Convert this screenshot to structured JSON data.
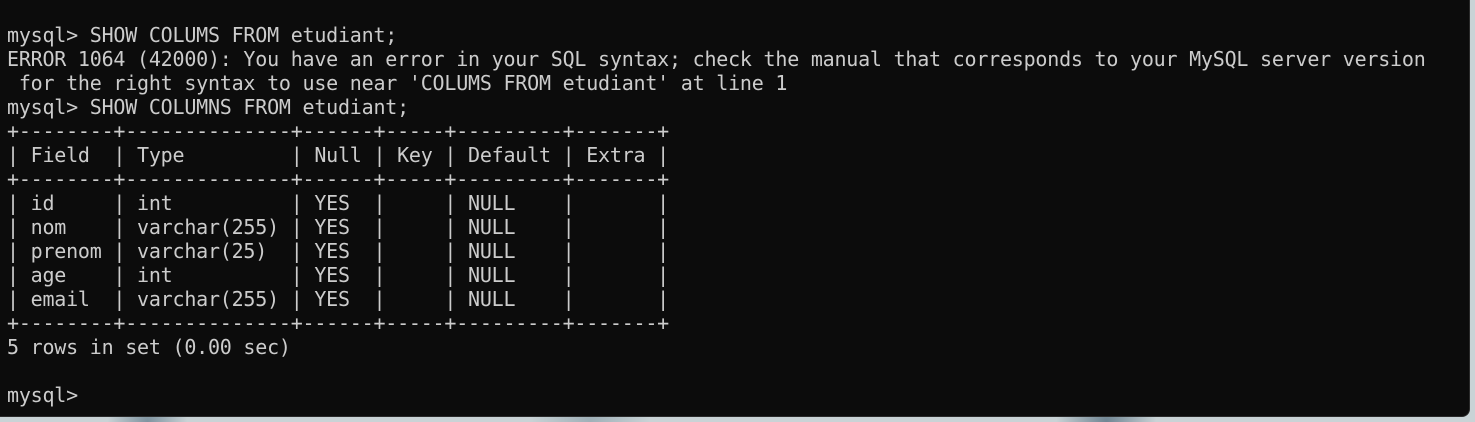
{
  "terminal": {
    "lines": [
      "mysql> SHOW COLUMS FROM etudiant;",
      "ERROR 1064 (42000): You have an error in your SQL syntax; check the manual that corresponds to your MySQL server version",
      " for the right syntax to use near 'COLUMS FROM etudiant' at line 1",
      "mysql> SHOW COLUMNS FROM etudiant;",
      "+--------+--------------+------+-----+---------+-------+",
      "| Field  | Type         | Null | Key | Default | Extra |",
      "+--------+--------------+------+-----+---------+-------+",
      "| id     | int          | YES  |     | NULL    |       |",
      "| nom    | varchar(255) | YES  |     | NULL    |       |",
      "| prenom | varchar(25)  | YES  |     | NULL    |       |",
      "| age    | int          | YES  |     | NULL    |       |",
      "| email  | varchar(255) | YES  |     | NULL    |       |",
      "+--------+--------------+------+-----+---------+-------+",
      "5 rows in set (0.00 sec)",
      "",
      "mysql> "
    ]
  },
  "colors": {
    "background": "#0c0c0c",
    "foreground": "#cccccc"
  }
}
